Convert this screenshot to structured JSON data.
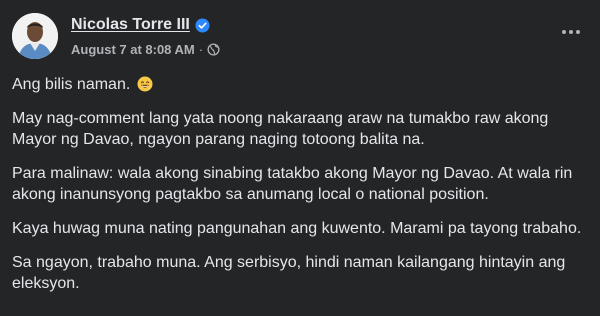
{
  "post": {
    "author": {
      "name": "Nicolas Torre III",
      "verified": true
    },
    "timestamp": "August 7 at 8:08 AM",
    "separator": "·",
    "audience_icon": "globe-icon",
    "menu_icon": "more-options-icon",
    "paragraphs": [
      {
        "text": "Ang bilis naman.",
        "emoji": "grinning-face-emoji"
      },
      {
        "text": "May nag-comment lang yata noong nakaraang araw na tumakbo raw akong Mayor ng Davao, ngayon parang naging totoong balita na."
      },
      {
        "text": "Para malinaw: wala akong sinabing tatakbo akong Mayor ng Davao. At wala rin akong inanunsyong pagtakbo sa anumang local o national position."
      },
      {
        "text": "Kaya huwag muna nating pangunahan ang kuwento. Marami pa tayong trabaho."
      },
      {
        "text": "Sa ngayon, trabaho muna. Ang serbisyo, hindi naman kailangang hintayin ang eleksyon."
      }
    ]
  },
  "colors": {
    "background": "#242526",
    "primary_text": "#e4e6eb",
    "secondary_text": "#b0b3b8",
    "verified_badge": "#2d88ff",
    "emoji": "#f7c948"
  }
}
